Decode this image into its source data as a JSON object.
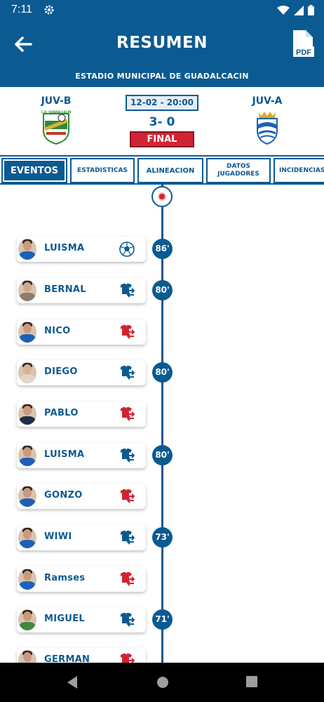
{
  "status": {
    "time": "7:11"
  },
  "header": {
    "title": "RESUMEN",
    "stadium": "ESTADIO MUNICIPAL DE GUADALCACIN",
    "back_icon": "arrow-left-icon",
    "pdf_icon": "pdf-icon",
    "pdf_label": "PDF"
  },
  "match": {
    "home_team": "JUV-B",
    "away_team": "JUV-A",
    "datetime": "12-02 - 20:00",
    "score": "3- 0",
    "status": "FINAL"
  },
  "tabs": [
    {
      "label": "EVENTOS"
    },
    {
      "label": "ESTADISTICAS"
    },
    {
      "label": "ALINEACION"
    },
    {
      "label": "DATOS JUGADORES"
    },
    {
      "label": "INCIDENCIAS"
    }
  ],
  "events": [
    {
      "player": "LUISMA",
      "type": "goal",
      "icon": "soccer-ball-icon",
      "minute": "86'"
    },
    {
      "player": "BERNAL",
      "type": "sub_in",
      "icon": "substitution-in-icon",
      "minute": "80'"
    },
    {
      "player": "NICO",
      "type": "sub_out",
      "icon": "substitution-out-icon",
      "minute": ""
    },
    {
      "player": "DIEGO",
      "type": "sub_in",
      "icon": "substitution-in-icon",
      "minute": "80'"
    },
    {
      "player": "PABLO",
      "type": "sub_out",
      "icon": "substitution-out-icon",
      "minute": ""
    },
    {
      "player": "LUISMA",
      "type": "sub_in",
      "icon": "substitution-in-icon",
      "minute": "80'"
    },
    {
      "player": "GONZO",
      "type": "sub_out",
      "icon": "substitution-out-icon",
      "minute": ""
    },
    {
      "player": "WIWI",
      "type": "sub_in",
      "icon": "substitution-in-icon",
      "minute": "73'"
    },
    {
      "player": "Ramses",
      "type": "sub_out",
      "icon": "substitution-out-icon",
      "minute": ""
    },
    {
      "player": "MIGUEL",
      "type": "sub_in",
      "icon": "substitution-in-icon",
      "minute": "71'"
    },
    {
      "player": "GERMAN",
      "type": "sub_out",
      "icon": "substitution-out-icon",
      "minute": ""
    }
  ],
  "colors": {
    "primary": "#0b5a92",
    "accent": "#d22334"
  }
}
